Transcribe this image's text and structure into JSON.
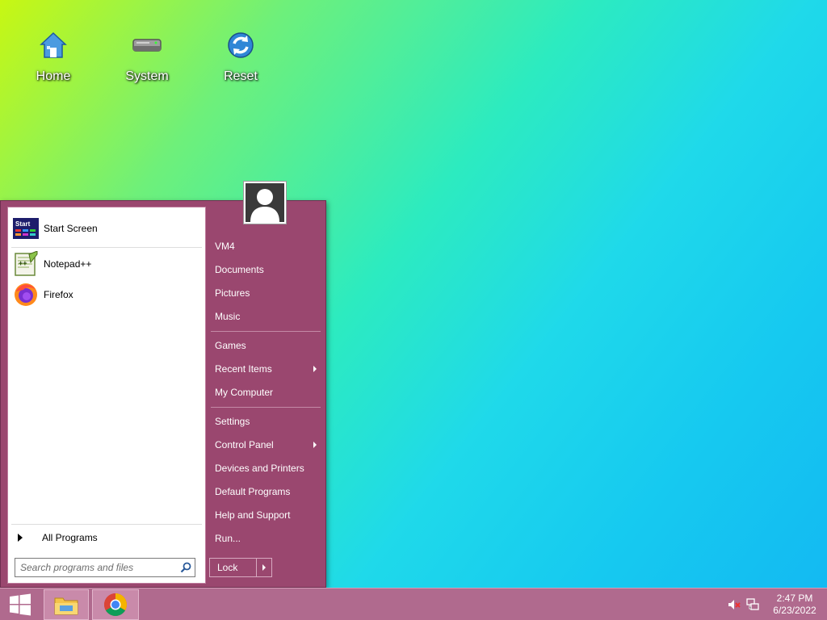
{
  "desktop": {
    "icons": [
      {
        "label": "Home",
        "icon": "home-icon"
      },
      {
        "label": "System",
        "icon": "drive-icon"
      },
      {
        "label": "Reset",
        "icon": "reset-icon"
      }
    ]
  },
  "start_menu": {
    "pinned": [
      {
        "label": "Start Screen",
        "icon": "start-screen-icon",
        "badge": "Start"
      },
      {
        "label": "Notepad++",
        "icon": "notepadpp-icon"
      },
      {
        "label": "Firefox",
        "icon": "firefox-icon"
      }
    ],
    "all_programs": "All Programs",
    "search_placeholder": "Search programs and files",
    "right_items": [
      {
        "label": "VM4"
      },
      {
        "label": "Documents"
      },
      {
        "label": "Pictures"
      },
      {
        "label": "Music"
      },
      {
        "label": "Games"
      },
      {
        "label": "Recent Items",
        "submenu": true
      },
      {
        "label": "My Computer"
      },
      {
        "label": "Settings"
      },
      {
        "label": "Control Panel",
        "submenu": true
      },
      {
        "label": "Devices and Printers"
      },
      {
        "label": "Default Programs"
      },
      {
        "label": "Help and Support"
      },
      {
        "label": "Run..."
      }
    ],
    "lock_label": "Lock"
  },
  "taskbar": {
    "buttons": [
      {
        "name": "start-button",
        "icon": "windows-icon"
      },
      {
        "name": "file-explorer",
        "icon": "folder-icon"
      },
      {
        "name": "chrome",
        "icon": "chrome-icon"
      }
    ],
    "time": "2:47 PM",
    "date": "6/23/2022"
  }
}
